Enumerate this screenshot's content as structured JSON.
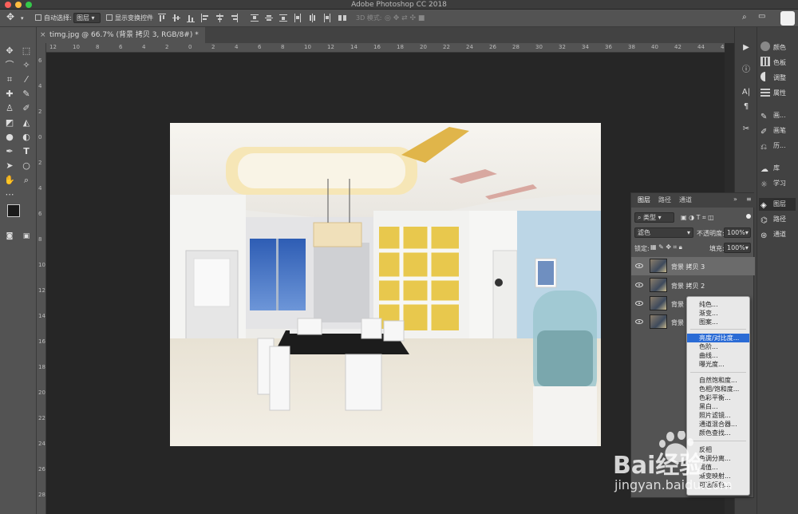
{
  "window": {
    "title": "Adobe Photoshop CC 2018"
  },
  "options_bar": {
    "auto_select_label": "自动选择:",
    "auto_select_value": "图层",
    "show_transform_label": "显示变换控件",
    "mode_3d_label": "3D 模式:"
  },
  "document_tab": {
    "label": "timg.jpg @ 66.7% (背景 拷贝 3, RGB/8#) *"
  },
  "rulers": {
    "horizontal": [
      "12",
      "10",
      "8",
      "6",
      "4",
      "2",
      "0",
      "2",
      "4",
      "6",
      "8",
      "10",
      "12",
      "14",
      "16",
      "18",
      "20",
      "22",
      "24",
      "26",
      "28",
      "30",
      "32",
      "34",
      "36",
      "38",
      "40",
      "42",
      "44",
      "46"
    ],
    "vertical": [
      "6",
      "4",
      "2",
      "0",
      "2",
      "4",
      "6",
      "8",
      "10",
      "12",
      "14",
      "16",
      "18",
      "20",
      "22",
      "24",
      "26",
      "28"
    ]
  },
  "right_panels": {
    "group1": [
      "颜色",
      "色板",
      "调整",
      "属性"
    ],
    "group2": [
      "画...",
      "画笔",
      "历..."
    ],
    "group3": [
      "库",
      "学习"
    ],
    "group4": [
      "图层",
      "路径",
      "通道"
    ]
  },
  "layers_panel": {
    "tabs": [
      "图层",
      "路径",
      "通道"
    ],
    "filter_label": "类型",
    "blend_mode": "滤色",
    "opacity_label": "不透明度:",
    "opacity_value": "100%",
    "lock_label": "锁定:",
    "fill_label": "填充:",
    "fill_value": "100%",
    "layers": [
      {
        "name": "背景 拷贝 3",
        "selected": true
      },
      {
        "name": "背景 拷贝 2",
        "selected": false
      },
      {
        "name": "背景 拷",
        "selected": false
      },
      {
        "name": "背景",
        "selected": false
      }
    ]
  },
  "adjustment_menu": {
    "groups": [
      [
        "纯色...",
        "渐变...",
        "图案..."
      ],
      [
        "亮度/对比度...",
        "色阶...",
        "曲线...",
        "曝光度..."
      ],
      [
        "自然饱和度...",
        "色相/饱和度...",
        "色彩平衡...",
        "黑白...",
        "照片滤镜...",
        "通道混合器...",
        "颜色查找..."
      ],
      [
        "反相",
        "色调分离...",
        "阈值...",
        "渐变映射...",
        "可选颜色..."
      ]
    ],
    "highlighted": "亮度/对比度..."
  },
  "watermark": {
    "brand": "Bai经验",
    "url": "jingyan.baidu.com"
  },
  "colors": {
    "menu_highlight": "#2a6bd5",
    "panel_bg": "#535353",
    "canvas_bg": "#262626"
  }
}
